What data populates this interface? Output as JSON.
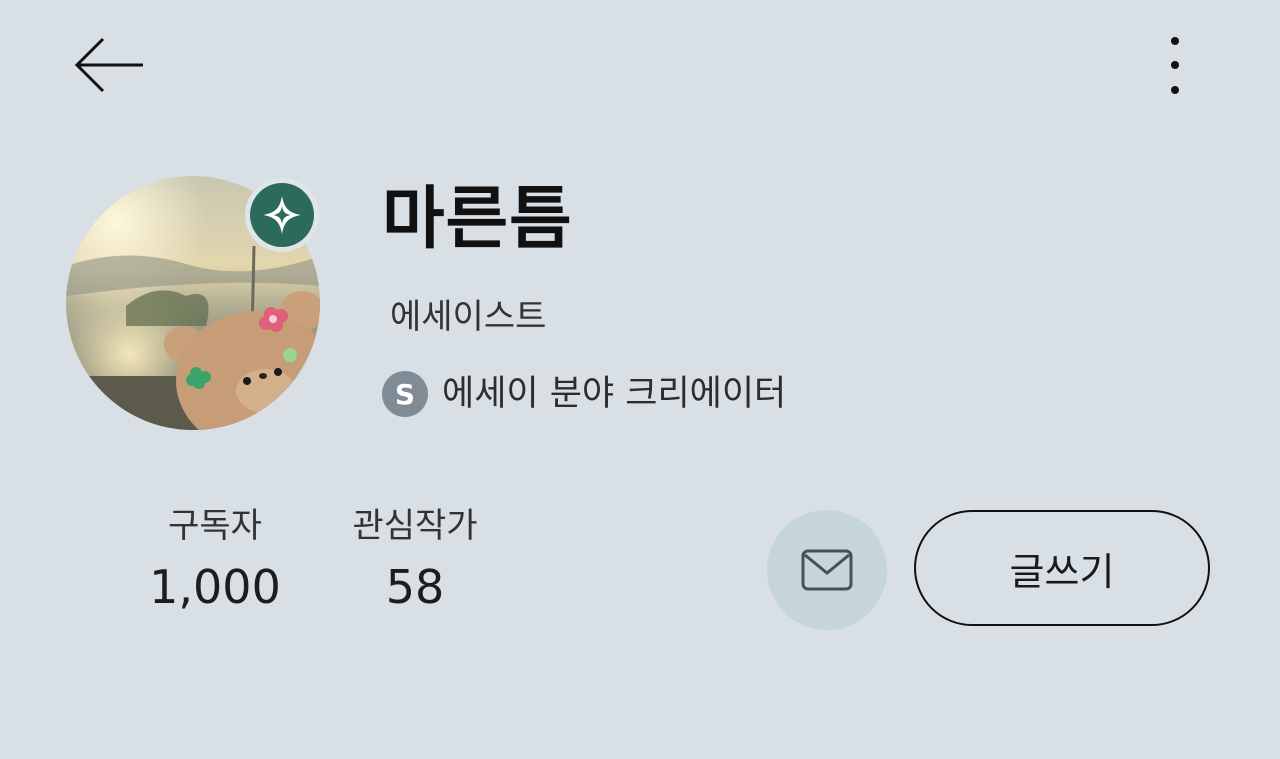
{
  "header": {
    "back_icon": "arrow-left-icon",
    "more_icon": "kebab-menu-icon"
  },
  "profile": {
    "name": "마른틈",
    "occupation": "에세이스트",
    "creator_badge_letter": "S",
    "creator_label": "에세이 분야 크리에이터",
    "badge_icon": "verified-sparkle-icon",
    "badge_color": "#2c6a5a"
  },
  "stats": {
    "subscribers_label": "구독자",
    "subscribers_value": "1,000",
    "following_label": "관심작가",
    "following_value": "58"
  },
  "actions": {
    "mail_icon": "envelope-icon",
    "write_label": "글쓰기"
  },
  "colors": {
    "background": "#d8dfe5",
    "mail_button_bg": "#c6d4dc",
    "creator_badge_bg": "#7f8b95"
  }
}
